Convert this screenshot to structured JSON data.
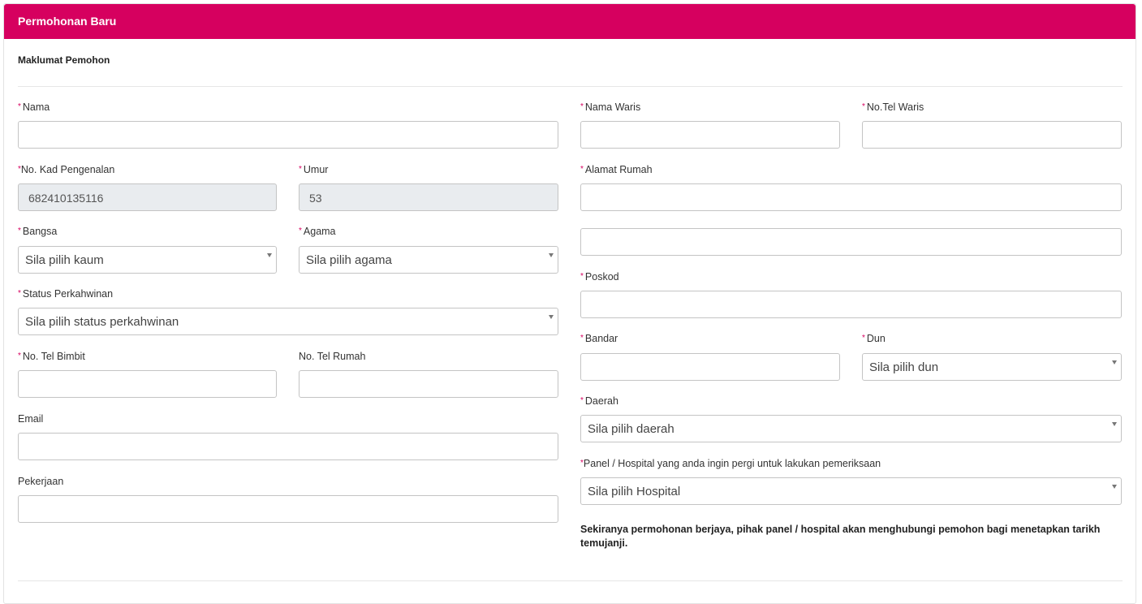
{
  "header": {
    "title": "Permohonan Baru"
  },
  "section": {
    "title": "Maklumat Pemohon"
  },
  "colors": {
    "accent": "#d6005f",
    "required": "#d6005f",
    "readonly_bg": "#e9ecef"
  },
  "left": {
    "nama": {
      "label": "Nama",
      "value": ""
    },
    "ic": {
      "label": "No. Kad Pengenalan",
      "value": "682410135116"
    },
    "umur": {
      "label": "Umur",
      "value": "53"
    },
    "bangsa": {
      "label": "Bangsa",
      "selected": "Sila pilih kaum"
    },
    "agama": {
      "label": "Agama",
      "selected": "Sila pilih agama"
    },
    "status": {
      "label": "Status Perkahwinan",
      "selected": "Sila pilih status perkahwinan"
    },
    "tel_bimbit": {
      "label": "No. Tel Bimbit",
      "value": ""
    },
    "tel_rumah": {
      "label": "No. Tel Rumah",
      "value": ""
    },
    "email": {
      "label": "Email",
      "value": ""
    },
    "pekerjaan": {
      "label": "Pekerjaan",
      "value": ""
    }
  },
  "right": {
    "nama_waris": {
      "label": "Nama Waris",
      "value": ""
    },
    "tel_waris": {
      "label": "No.Tel Waris",
      "value": ""
    },
    "alamat": {
      "label": "Alamat Rumah",
      "line1": "",
      "line2": ""
    },
    "poskod": {
      "label": "Poskod",
      "value": ""
    },
    "bandar": {
      "label": "Bandar",
      "value": ""
    },
    "dun": {
      "label": "Dun",
      "selected": "Sila pilih dun"
    },
    "daerah": {
      "label": "Daerah",
      "selected": "Sila pilih daerah"
    },
    "hospital": {
      "label": "Panel / Hospital yang anda ingin pergi untuk lakukan pemeriksaan",
      "selected": "Sila pilih Hospital"
    }
  },
  "note": "Sekiranya permohonan berjaya, pihak panel / hospital akan menghubungi pemohon bagi menetapkan tarikh temujanji.",
  "required_mark": "*"
}
